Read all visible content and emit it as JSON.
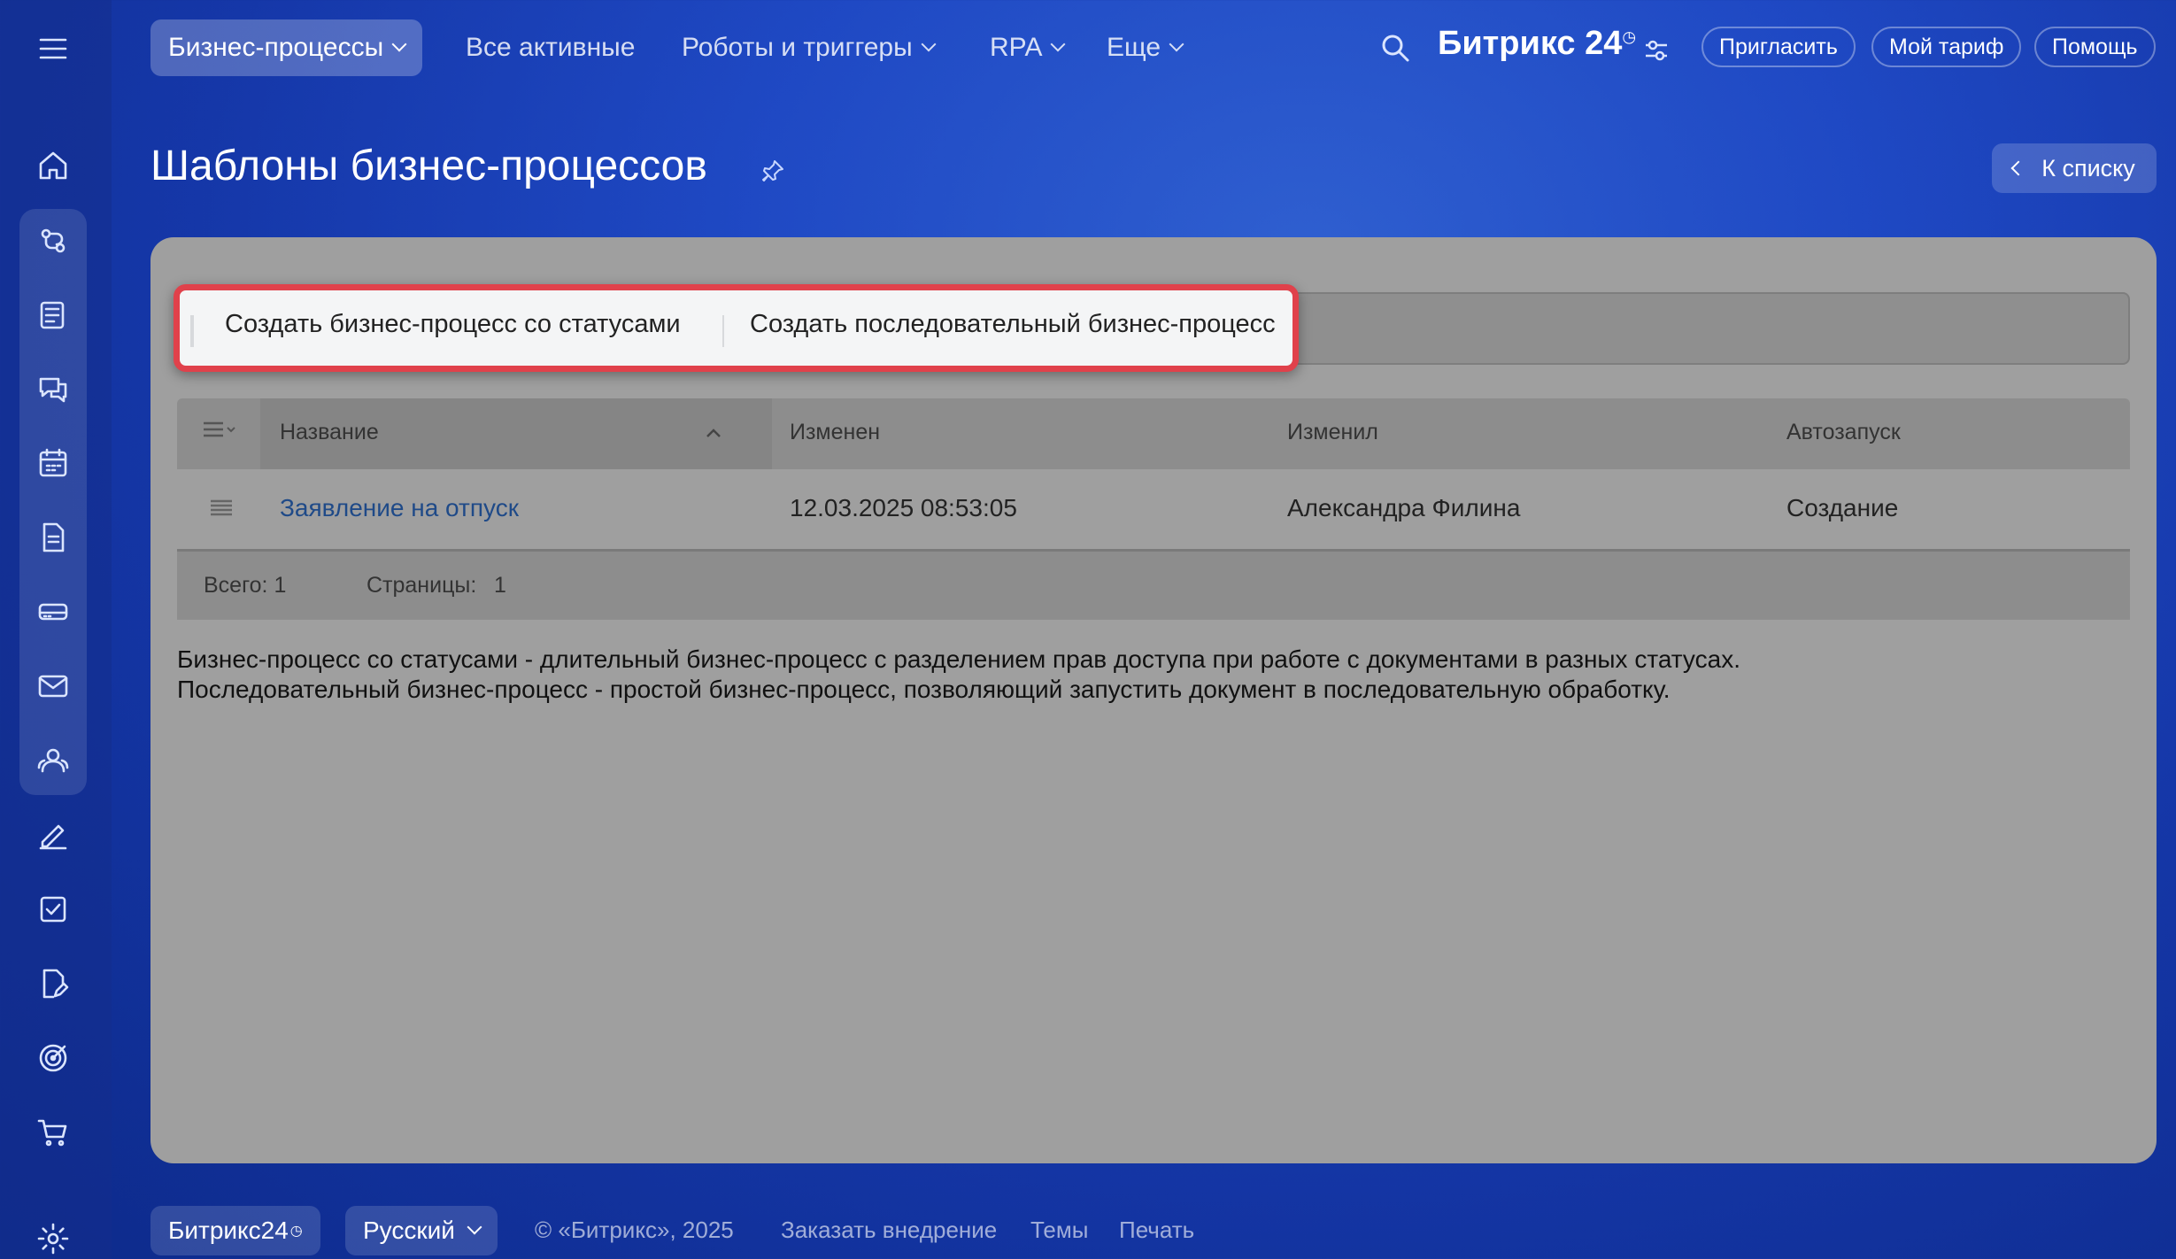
{
  "nav": {
    "items": [
      {
        "label": "Бизнес-процессы",
        "has_menu": true
      },
      {
        "label": "Все активные",
        "has_menu": false
      },
      {
        "label": "Роботы и триггеры",
        "has_menu": true
      },
      {
        "label": "RPA",
        "has_menu": true
      },
      {
        "label": "Еще",
        "has_menu": true
      }
    ],
    "brand": "Битрикс 24",
    "invite": "Пригласить",
    "tariff": "Мой тариф",
    "help": "Помощь"
  },
  "sidebar": {
    "icons": [
      "menu-icon",
      "home-icon",
      "bizproc-icon",
      "news-icon",
      "chat-icon",
      "calendar-icon",
      "document-icon",
      "drive-icon",
      "mail-icon",
      "team-icon",
      "sign-icon",
      "task-icon",
      "form-icon",
      "target-icon",
      "cart-icon",
      "settings-icon"
    ]
  },
  "page": {
    "title": "Шаблоны бизнес-процессов",
    "back_label": "К списку"
  },
  "toolbar": {
    "create_status": "Создать бизнес-процесс со статусами",
    "create_sequential": "Создать последовательный бизнес-процесс"
  },
  "table": {
    "headers": {
      "name": "Название",
      "modified": "Изменен",
      "modified_by": "Изменил",
      "autostart": "Автозапуск"
    },
    "rows": [
      {
        "name": "Заявление на отпуск",
        "modified": "12.03.2025 08:53:05",
        "modified_by": "Александра Филина",
        "autostart": "Создание"
      }
    ],
    "total_label": "Всего: 1",
    "pages_label": "Страницы:",
    "pages_value": "1"
  },
  "description": {
    "line1": "Бизнес-процесс со статусами - длительный бизнес-процесс с разделением прав доступа при работе с документами в разных статусах.",
    "line2": "Последовательный бизнес-процесс - простой бизнес-процесс, позволяющий запустить документ в последовательную обработку."
  },
  "footer": {
    "brand": "Битрикс24",
    "language": "Русский",
    "copyright": "© «Битрикс», 2025",
    "order": "Заказать внедрение",
    "themes": "Темы",
    "print": "Печать"
  },
  "colors": {
    "highlight": "#e0414b",
    "link": "#1f4a88"
  }
}
